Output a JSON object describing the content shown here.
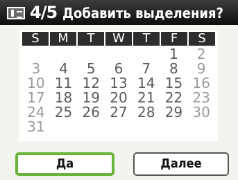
{
  "header": {
    "icon": "calendar-mode-icon",
    "page": "4/5",
    "title": "Добавить выделения?"
  },
  "calendar": {
    "weekdays": [
      "S",
      "M",
      "T",
      "W",
      "T",
      "F",
      "S"
    ],
    "days": [
      "",
      "",
      "",
      "",
      "",
      "1",
      "2",
      "3",
      "4",
      "5",
      "6",
      "7",
      "8",
      "9",
      "10",
      "11",
      "12",
      "13",
      "14",
      "15",
      "16",
      "17",
      "18",
      "19",
      "20",
      "21",
      "22",
      "23",
      "24",
      "25",
      "26",
      "27",
      "28",
      "29",
      "30",
      "31",
      "",
      "",
      "",
      "",
      "",
      ""
    ]
  },
  "buttons": {
    "yes_label": "Да",
    "next_label": "Далее"
  },
  "colors": {
    "focus_border": "#6ab43b",
    "header_bg": "#1c1c1c"
  }
}
